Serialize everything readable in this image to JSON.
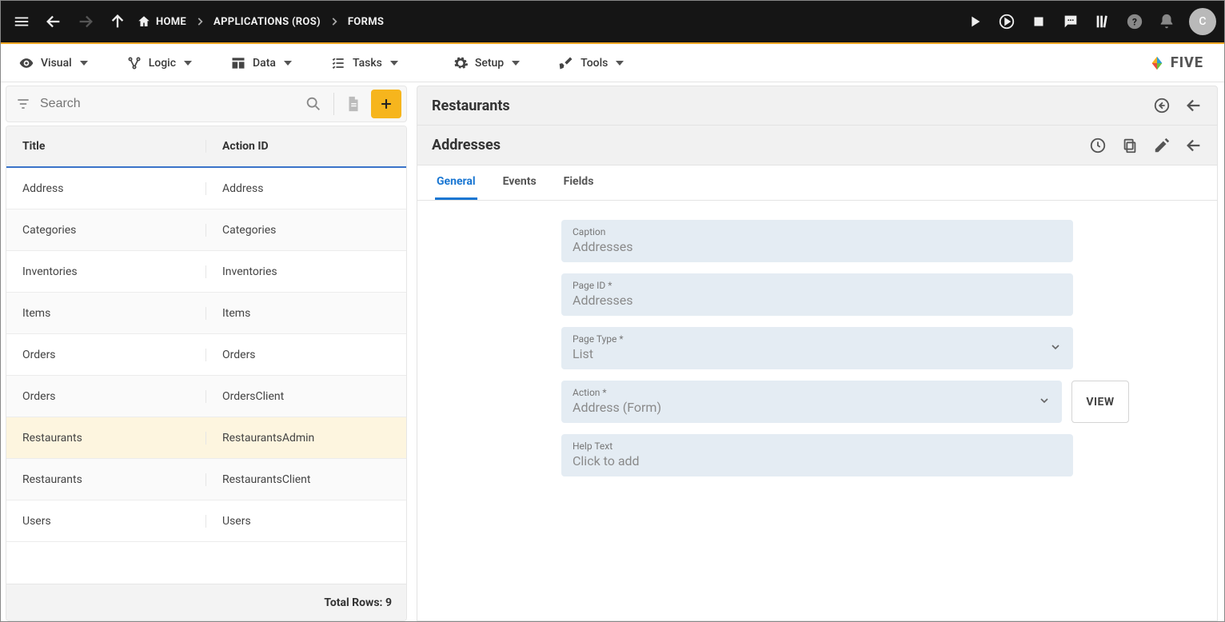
{
  "topbar": {
    "home_label": "HOME",
    "crumbs": [
      "APPLICATIONS (ROS)",
      "FORMS"
    ],
    "avatar_letter": "C"
  },
  "menubar": {
    "items": [
      {
        "label": "Visual",
        "icon": "eye"
      },
      {
        "label": "Logic",
        "icon": "logic"
      },
      {
        "label": "Data",
        "icon": "table"
      },
      {
        "label": "Tasks",
        "icon": "list"
      },
      {
        "label": "Setup",
        "icon": "gear"
      },
      {
        "label": "Tools",
        "icon": "tools"
      }
    ],
    "brand": "FIVE"
  },
  "left": {
    "search_placeholder": "Search",
    "columns": [
      "Title",
      "Action ID"
    ],
    "rows": [
      {
        "title": "Address",
        "action_id": "Address"
      },
      {
        "title": "Categories",
        "action_id": "Categories"
      },
      {
        "title": "Inventories",
        "action_id": "Inventories"
      },
      {
        "title": "Items",
        "action_id": "Items"
      },
      {
        "title": "Orders",
        "action_id": "Orders"
      },
      {
        "title": "Orders",
        "action_id": "OrdersClient"
      },
      {
        "title": "Restaurants",
        "action_id": "RestaurantsAdmin"
      },
      {
        "title": "Restaurants",
        "action_id": "RestaurantsClient"
      },
      {
        "title": "Users",
        "action_id": "Users"
      }
    ],
    "selected_index": 6,
    "footer_label": "Total Rows:",
    "total_rows": 9
  },
  "right": {
    "header_title": "Restaurants",
    "sub_title": "Addresses",
    "tabs": [
      "General",
      "Events",
      "Fields"
    ],
    "active_tab": 0,
    "fields": {
      "caption": {
        "label": "Caption",
        "value": "Addresses"
      },
      "page_id": {
        "label": "Page ID *",
        "value": "Addresses"
      },
      "page_type": {
        "label": "Page Type *",
        "value": "List"
      },
      "action": {
        "label": "Action *",
        "value": "Address (Form)"
      },
      "help_text": {
        "label": "Help Text",
        "value": "Click to add"
      }
    },
    "view_button": "VIEW"
  }
}
